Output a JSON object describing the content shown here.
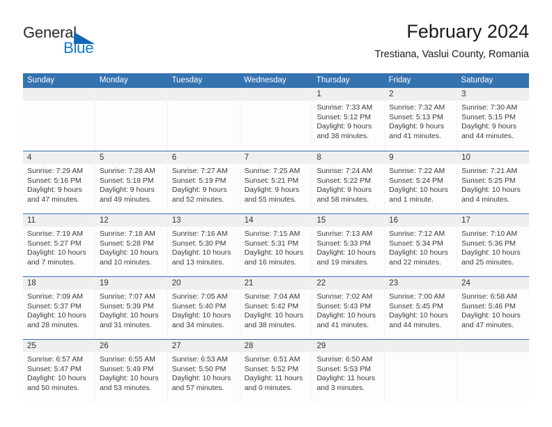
{
  "brand": {
    "name_part1": "General",
    "name_part2": "Blue",
    "triangle_color": "#1266b5",
    "blue_color": "#1479c4"
  },
  "header": {
    "title": "February 2024",
    "subtitle": "Trestiana, Vaslui County, Romania"
  },
  "theme": {
    "header_bar_color": "#3572b0",
    "day_number_band_color": "#efefef",
    "cell_background": "#fdfdff"
  },
  "weekdays": [
    "Sunday",
    "Monday",
    "Tuesday",
    "Wednesday",
    "Thursday",
    "Friday",
    "Saturday"
  ],
  "weeks": [
    [
      {
        "day": "",
        "sunrise": "",
        "sunset": "",
        "daylight_line1": "",
        "daylight_line2": ""
      },
      {
        "day": "",
        "sunrise": "",
        "sunset": "",
        "daylight_line1": "",
        "daylight_line2": ""
      },
      {
        "day": "",
        "sunrise": "",
        "sunset": "",
        "daylight_line1": "",
        "daylight_line2": ""
      },
      {
        "day": "",
        "sunrise": "",
        "sunset": "",
        "daylight_line1": "",
        "daylight_line2": ""
      },
      {
        "day": "1",
        "sunrise": "Sunrise: 7:33 AM",
        "sunset": "Sunset: 5:12 PM",
        "daylight_line1": "Daylight: 9 hours",
        "daylight_line2": "and 38 minutes."
      },
      {
        "day": "2",
        "sunrise": "Sunrise: 7:32 AM",
        "sunset": "Sunset: 5:13 PM",
        "daylight_line1": "Daylight: 9 hours",
        "daylight_line2": "and 41 minutes."
      },
      {
        "day": "3",
        "sunrise": "Sunrise: 7:30 AM",
        "sunset": "Sunset: 5:15 PM",
        "daylight_line1": "Daylight: 9 hours",
        "daylight_line2": "and 44 minutes."
      }
    ],
    [
      {
        "day": "4",
        "sunrise": "Sunrise: 7:29 AM",
        "sunset": "Sunset: 5:16 PM",
        "daylight_line1": "Daylight: 9 hours",
        "daylight_line2": "and 47 minutes."
      },
      {
        "day": "5",
        "sunrise": "Sunrise: 7:28 AM",
        "sunset": "Sunset: 5:18 PM",
        "daylight_line1": "Daylight: 9 hours",
        "daylight_line2": "and 49 minutes."
      },
      {
        "day": "6",
        "sunrise": "Sunrise: 7:27 AM",
        "sunset": "Sunset: 5:19 PM",
        "daylight_line1": "Daylight: 9 hours",
        "daylight_line2": "and 52 minutes."
      },
      {
        "day": "7",
        "sunrise": "Sunrise: 7:25 AM",
        "sunset": "Sunset: 5:21 PM",
        "daylight_line1": "Daylight: 9 hours",
        "daylight_line2": "and 55 minutes."
      },
      {
        "day": "8",
        "sunrise": "Sunrise: 7:24 AM",
        "sunset": "Sunset: 5:22 PM",
        "daylight_line1": "Daylight: 9 hours",
        "daylight_line2": "and 58 minutes."
      },
      {
        "day": "9",
        "sunrise": "Sunrise: 7:22 AM",
        "sunset": "Sunset: 5:24 PM",
        "daylight_line1": "Daylight: 10 hours",
        "daylight_line2": "and 1 minute."
      },
      {
        "day": "10",
        "sunrise": "Sunrise: 7:21 AM",
        "sunset": "Sunset: 5:25 PM",
        "daylight_line1": "Daylight: 10 hours",
        "daylight_line2": "and 4 minutes."
      }
    ],
    [
      {
        "day": "11",
        "sunrise": "Sunrise: 7:19 AM",
        "sunset": "Sunset: 5:27 PM",
        "daylight_line1": "Daylight: 10 hours",
        "daylight_line2": "and 7 minutes."
      },
      {
        "day": "12",
        "sunrise": "Sunrise: 7:18 AM",
        "sunset": "Sunset: 5:28 PM",
        "daylight_line1": "Daylight: 10 hours",
        "daylight_line2": "and 10 minutes."
      },
      {
        "day": "13",
        "sunrise": "Sunrise: 7:16 AM",
        "sunset": "Sunset: 5:30 PM",
        "daylight_line1": "Daylight: 10 hours",
        "daylight_line2": "and 13 minutes."
      },
      {
        "day": "14",
        "sunrise": "Sunrise: 7:15 AM",
        "sunset": "Sunset: 5:31 PM",
        "daylight_line1": "Daylight: 10 hours",
        "daylight_line2": "and 16 minutes."
      },
      {
        "day": "15",
        "sunrise": "Sunrise: 7:13 AM",
        "sunset": "Sunset: 5:33 PM",
        "daylight_line1": "Daylight: 10 hours",
        "daylight_line2": "and 19 minutes."
      },
      {
        "day": "16",
        "sunrise": "Sunrise: 7:12 AM",
        "sunset": "Sunset: 5:34 PM",
        "daylight_line1": "Daylight: 10 hours",
        "daylight_line2": "and 22 minutes."
      },
      {
        "day": "17",
        "sunrise": "Sunrise: 7:10 AM",
        "sunset": "Sunset: 5:36 PM",
        "daylight_line1": "Daylight: 10 hours",
        "daylight_line2": "and 25 minutes."
      }
    ],
    [
      {
        "day": "18",
        "sunrise": "Sunrise: 7:09 AM",
        "sunset": "Sunset: 5:37 PM",
        "daylight_line1": "Daylight: 10 hours",
        "daylight_line2": "and 28 minutes."
      },
      {
        "day": "19",
        "sunrise": "Sunrise: 7:07 AM",
        "sunset": "Sunset: 5:39 PM",
        "daylight_line1": "Daylight: 10 hours",
        "daylight_line2": "and 31 minutes."
      },
      {
        "day": "20",
        "sunrise": "Sunrise: 7:05 AM",
        "sunset": "Sunset: 5:40 PM",
        "daylight_line1": "Daylight: 10 hours",
        "daylight_line2": "and 34 minutes."
      },
      {
        "day": "21",
        "sunrise": "Sunrise: 7:04 AM",
        "sunset": "Sunset: 5:42 PM",
        "daylight_line1": "Daylight: 10 hours",
        "daylight_line2": "and 38 minutes."
      },
      {
        "day": "22",
        "sunrise": "Sunrise: 7:02 AM",
        "sunset": "Sunset: 5:43 PM",
        "daylight_line1": "Daylight: 10 hours",
        "daylight_line2": "and 41 minutes."
      },
      {
        "day": "23",
        "sunrise": "Sunrise: 7:00 AM",
        "sunset": "Sunset: 5:45 PM",
        "daylight_line1": "Daylight: 10 hours",
        "daylight_line2": "and 44 minutes."
      },
      {
        "day": "24",
        "sunrise": "Sunrise: 6:58 AM",
        "sunset": "Sunset: 5:46 PM",
        "daylight_line1": "Daylight: 10 hours",
        "daylight_line2": "and 47 minutes."
      }
    ],
    [
      {
        "day": "25",
        "sunrise": "Sunrise: 6:57 AM",
        "sunset": "Sunset: 5:47 PM",
        "daylight_line1": "Daylight: 10 hours",
        "daylight_line2": "and 50 minutes."
      },
      {
        "day": "26",
        "sunrise": "Sunrise: 6:55 AM",
        "sunset": "Sunset: 5:49 PM",
        "daylight_line1": "Daylight: 10 hours",
        "daylight_line2": "and 53 minutes."
      },
      {
        "day": "27",
        "sunrise": "Sunrise: 6:53 AM",
        "sunset": "Sunset: 5:50 PM",
        "daylight_line1": "Daylight: 10 hours",
        "daylight_line2": "and 57 minutes."
      },
      {
        "day": "28",
        "sunrise": "Sunrise: 6:51 AM",
        "sunset": "Sunset: 5:52 PM",
        "daylight_line1": "Daylight: 11 hours",
        "daylight_line2": "and 0 minutes."
      },
      {
        "day": "29",
        "sunrise": "Sunrise: 6:50 AM",
        "sunset": "Sunset: 5:53 PM",
        "daylight_line1": "Daylight: 11 hours",
        "daylight_line2": "and 3 minutes."
      },
      {
        "day": "",
        "sunrise": "",
        "sunset": "",
        "daylight_line1": "",
        "daylight_line2": ""
      },
      {
        "day": "",
        "sunrise": "",
        "sunset": "",
        "daylight_line1": "",
        "daylight_line2": ""
      }
    ]
  ]
}
